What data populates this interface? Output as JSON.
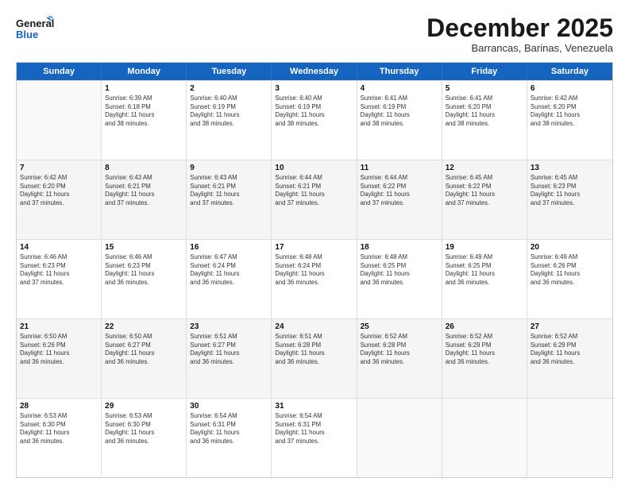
{
  "logo": {
    "line1": "General",
    "line2": "Blue"
  },
  "header": {
    "month": "December 2025",
    "location": "Barrancas, Barinas, Venezuela"
  },
  "days": [
    "Sunday",
    "Monday",
    "Tuesday",
    "Wednesday",
    "Thursday",
    "Friday",
    "Saturday"
  ],
  "rows": [
    [
      {
        "day": "",
        "text": ""
      },
      {
        "day": "1",
        "text": "Sunrise: 6:39 AM\nSunset: 6:18 PM\nDaylight: 11 hours\nand 38 minutes."
      },
      {
        "day": "2",
        "text": "Sunrise: 6:40 AM\nSunset: 6:19 PM\nDaylight: 11 hours\nand 38 minutes."
      },
      {
        "day": "3",
        "text": "Sunrise: 6:40 AM\nSunset: 6:19 PM\nDaylight: 11 hours\nand 38 minutes."
      },
      {
        "day": "4",
        "text": "Sunrise: 6:41 AM\nSunset: 6:19 PM\nDaylight: 11 hours\nand 38 minutes."
      },
      {
        "day": "5",
        "text": "Sunrise: 6:41 AM\nSunset: 6:20 PM\nDaylight: 11 hours\nand 38 minutes."
      },
      {
        "day": "6",
        "text": "Sunrise: 6:42 AM\nSunset: 6:20 PM\nDaylight: 11 hours\nand 38 minutes."
      }
    ],
    [
      {
        "day": "7",
        "text": "Sunrise: 6:42 AM\nSunset: 6:20 PM\nDaylight: 11 hours\nand 37 minutes."
      },
      {
        "day": "8",
        "text": "Sunrise: 6:43 AM\nSunset: 6:21 PM\nDaylight: 11 hours\nand 37 minutes."
      },
      {
        "day": "9",
        "text": "Sunrise: 6:43 AM\nSunset: 6:21 PM\nDaylight: 11 hours\nand 37 minutes."
      },
      {
        "day": "10",
        "text": "Sunrise: 6:44 AM\nSunset: 6:21 PM\nDaylight: 11 hours\nand 37 minutes."
      },
      {
        "day": "11",
        "text": "Sunrise: 6:44 AM\nSunset: 6:22 PM\nDaylight: 11 hours\nand 37 minutes."
      },
      {
        "day": "12",
        "text": "Sunrise: 6:45 AM\nSunset: 6:22 PM\nDaylight: 11 hours\nand 37 minutes."
      },
      {
        "day": "13",
        "text": "Sunrise: 6:45 AM\nSunset: 6:23 PM\nDaylight: 11 hours\nand 37 minutes."
      }
    ],
    [
      {
        "day": "14",
        "text": "Sunrise: 6:46 AM\nSunset: 6:23 PM\nDaylight: 11 hours\nand 37 minutes."
      },
      {
        "day": "15",
        "text": "Sunrise: 6:46 AM\nSunset: 6:23 PM\nDaylight: 11 hours\nand 36 minutes."
      },
      {
        "day": "16",
        "text": "Sunrise: 6:47 AM\nSunset: 6:24 PM\nDaylight: 11 hours\nand 36 minutes."
      },
      {
        "day": "17",
        "text": "Sunrise: 6:48 AM\nSunset: 6:24 PM\nDaylight: 11 hours\nand 36 minutes."
      },
      {
        "day": "18",
        "text": "Sunrise: 6:48 AM\nSunset: 6:25 PM\nDaylight: 11 hours\nand 36 minutes."
      },
      {
        "day": "19",
        "text": "Sunrise: 6:49 AM\nSunset: 6:25 PM\nDaylight: 11 hours\nand 36 minutes."
      },
      {
        "day": "20",
        "text": "Sunrise: 6:49 AM\nSunset: 6:26 PM\nDaylight: 11 hours\nand 36 minutes."
      }
    ],
    [
      {
        "day": "21",
        "text": "Sunrise: 6:50 AM\nSunset: 6:26 PM\nDaylight: 11 hours\nand 36 minutes."
      },
      {
        "day": "22",
        "text": "Sunrise: 6:50 AM\nSunset: 6:27 PM\nDaylight: 11 hours\nand 36 minutes."
      },
      {
        "day": "23",
        "text": "Sunrise: 6:51 AM\nSunset: 6:27 PM\nDaylight: 11 hours\nand 36 minutes."
      },
      {
        "day": "24",
        "text": "Sunrise: 6:51 AM\nSunset: 6:28 PM\nDaylight: 11 hours\nand 36 minutes."
      },
      {
        "day": "25",
        "text": "Sunrise: 6:52 AM\nSunset: 6:28 PM\nDaylight: 11 hours\nand 36 minutes."
      },
      {
        "day": "26",
        "text": "Sunrise: 6:52 AM\nSunset: 6:29 PM\nDaylight: 11 hours\nand 36 minutes."
      },
      {
        "day": "27",
        "text": "Sunrise: 6:52 AM\nSunset: 6:29 PM\nDaylight: 11 hours\nand 36 minutes."
      }
    ],
    [
      {
        "day": "28",
        "text": "Sunrise: 6:53 AM\nSunset: 6:30 PM\nDaylight: 11 hours\nand 36 minutes."
      },
      {
        "day": "29",
        "text": "Sunrise: 6:53 AM\nSunset: 6:30 PM\nDaylight: 11 hours\nand 36 minutes."
      },
      {
        "day": "30",
        "text": "Sunrise: 6:54 AM\nSunset: 6:31 PM\nDaylight: 11 hours\nand 36 minutes."
      },
      {
        "day": "31",
        "text": "Sunrise: 6:54 AM\nSunset: 6:31 PM\nDaylight: 11 hours\nand 37 minutes."
      },
      {
        "day": "",
        "text": ""
      },
      {
        "day": "",
        "text": ""
      },
      {
        "day": "",
        "text": ""
      }
    ]
  ]
}
